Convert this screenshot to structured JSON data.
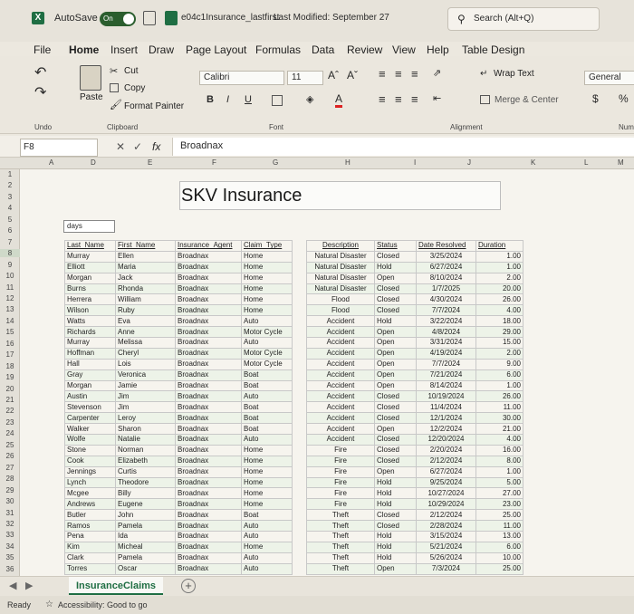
{
  "titlebar": {
    "autosave_label": "AutoSave",
    "autosave_state": "On",
    "filename": "e04c1Insurance_lastfirst",
    "last_modified": "Last Modified: September 27",
    "search_placeholder": "Search (Alt+Q)"
  },
  "menu": [
    "File",
    "Home",
    "Insert",
    "Draw",
    "Page Layout",
    "Formulas",
    "Data",
    "Review",
    "View",
    "Help",
    "Table Design"
  ],
  "ribbon": {
    "cut": "Cut",
    "copy": "Copy",
    "paste": "Paste",
    "format_painter": "Format Painter",
    "undo_label": "Undo",
    "clipboard_label": "Clipboard",
    "font_name": "Calibri",
    "font_size": "11",
    "font_label": "Font",
    "bold": "B",
    "italic": "I",
    "underline": "U",
    "wrap_text": "Wrap Text",
    "merge_center": "Merge & Center",
    "alignment_label": "Alignment",
    "number_format": "General",
    "currency": "$",
    "percent": "%",
    "number_label": "Num"
  },
  "formula_bar": {
    "cell_ref": "F8",
    "fx": "fx",
    "content": "Broadnax"
  },
  "columns": [
    "A",
    "D",
    "E",
    "F",
    "G",
    "H",
    "I",
    "J",
    "K",
    "L",
    "M"
  ],
  "rows": [
    "1",
    "2",
    "3",
    "4",
    "5",
    "6",
    "7",
    "8",
    "9",
    "10",
    "11",
    "12",
    "13",
    "14",
    "15",
    "16",
    "17",
    "18",
    "19",
    "20",
    "21",
    "22",
    "23",
    "24",
    "25",
    "26",
    "27",
    "28",
    "29",
    "30",
    "31",
    "32",
    "33",
    "34",
    "35",
    "36"
  ],
  "sheet": {
    "title": "SKV Insurance",
    "days_label": "days",
    "headers": [
      "Last_Name",
      "First_Name",
      "Insurance_Agent",
      "Claim_Type",
      "Description",
      "Status",
      "Date Resolved",
      "Duration"
    ],
    "records": [
      [
        "Murray",
        "Ellen",
        "Broadnax",
        "Home",
        "Natural Disaster",
        "Closed",
        "3/25/2024",
        "1.00"
      ],
      [
        "Elliott",
        "Maria",
        "Broadnax",
        "Home",
        "Natural Disaster",
        "Hold",
        "6/27/2024",
        "1.00"
      ],
      [
        "Morgan",
        "Jack",
        "Broadnax",
        "Home",
        "Natural Disaster",
        "Open",
        "8/10/2024",
        "2.00"
      ],
      [
        "Burns",
        "Rhonda",
        "Broadnax",
        "Home",
        "Natural Disaster",
        "Closed",
        "1/7/2025",
        "20.00"
      ],
      [
        "Herrera",
        "William",
        "Broadnax",
        "Home",
        "Flood",
        "Closed",
        "4/30/2024",
        "26.00"
      ],
      [
        "Wilson",
        "Ruby",
        "Broadnax",
        "Home",
        "Flood",
        "Closed",
        "7/7/2024",
        "4.00"
      ],
      [
        "Watts",
        "Eva",
        "Broadnax",
        "Auto",
        "Accident",
        "Hold",
        "3/22/2024",
        "18.00"
      ],
      [
        "Richards",
        "Anne",
        "Broadnax",
        "Motor Cycle",
        "Accident",
        "Open",
        "4/8/2024",
        "29.00"
      ],
      [
        "Murray",
        "Melissa",
        "Broadnax",
        "Auto",
        "Accident",
        "Open",
        "3/31/2024",
        "15.00"
      ],
      [
        "Hoffman",
        "Cheryl",
        "Broadnax",
        "Motor Cycle",
        "Accident",
        "Open",
        "4/19/2024",
        "2.00"
      ],
      [
        "Hall",
        "Lois",
        "Broadnax",
        "Motor Cycle",
        "Accident",
        "Open",
        "7/7/2024",
        "9.00"
      ],
      [
        "Gray",
        "Veronica",
        "Broadnax",
        "Boat",
        "Accident",
        "Open",
        "7/21/2024",
        "6.00"
      ],
      [
        "Morgan",
        "Jamie",
        "Broadnax",
        "Boat",
        "Accident",
        "Open",
        "8/14/2024",
        "1.00"
      ],
      [
        "Austin",
        "Jim",
        "Broadnax",
        "Auto",
        "Accident",
        "Closed",
        "10/19/2024",
        "26.00"
      ],
      [
        "Stevenson",
        "Jim",
        "Broadnax",
        "Boat",
        "Accident",
        "Closed",
        "11/4/2024",
        "11.00"
      ],
      [
        "Carpenter",
        "Leroy",
        "Broadnax",
        "Boat",
        "Accident",
        "Closed",
        "12/1/2024",
        "30.00"
      ],
      [
        "Walker",
        "Sharon",
        "Broadnax",
        "Boat",
        "Accident",
        "Open",
        "12/2/2024",
        "21.00"
      ],
      [
        "Wolfe",
        "Natalie",
        "Broadnax",
        "Auto",
        "Accident",
        "Closed",
        "12/20/2024",
        "4.00"
      ],
      [
        "Stone",
        "Norman",
        "Broadnax",
        "Home",
        "Fire",
        "Closed",
        "2/20/2024",
        "16.00"
      ],
      [
        "Cook",
        "Elizabeth",
        "Broadnax",
        "Home",
        "Fire",
        "Closed",
        "2/12/2024",
        "8.00"
      ],
      [
        "Jennings",
        "Curtis",
        "Broadnax",
        "Home",
        "Fire",
        "Open",
        "6/27/2024",
        "1.00"
      ],
      [
        "Lynch",
        "Theodore",
        "Broadnax",
        "Home",
        "Fire",
        "Hold",
        "9/25/2024",
        "5.00"
      ],
      [
        "Mcgee",
        "Billy",
        "Broadnax",
        "Home",
        "Fire",
        "Hold",
        "10/27/2024",
        "27.00"
      ],
      [
        "Andrews",
        "Eugene",
        "Broadnax",
        "Home",
        "Fire",
        "Hold",
        "10/29/2024",
        "23.00"
      ],
      [
        "Butler",
        "John",
        "Broadnax",
        "Boat",
        "Theft",
        "Closed",
        "2/12/2024",
        "25.00"
      ],
      [
        "Ramos",
        "Pamela",
        "Broadnax",
        "Auto",
        "Theft",
        "Closed",
        "2/28/2024",
        "11.00"
      ],
      [
        "Pena",
        "Ida",
        "Broadnax",
        "Auto",
        "Theft",
        "Hold",
        "3/15/2024",
        "13.00"
      ],
      [
        "Kim",
        "Micheal",
        "Broadnax",
        "Home",
        "Theft",
        "Hold",
        "5/21/2024",
        "6.00"
      ],
      [
        "Clark",
        "Pamela",
        "Broadnax",
        "Auto",
        "Theft",
        "Hold",
        "5/26/2024",
        "10.00"
      ],
      [
        "Torres",
        "Oscar",
        "Broadnax",
        "Auto",
        "Theft",
        "Open",
        "7/3/2024",
        "25.00"
      ]
    ]
  },
  "sheet_tab": "InsuranceClaims",
  "status": {
    "ready": "Ready",
    "accessibility": "Accessibility: Good to go"
  }
}
